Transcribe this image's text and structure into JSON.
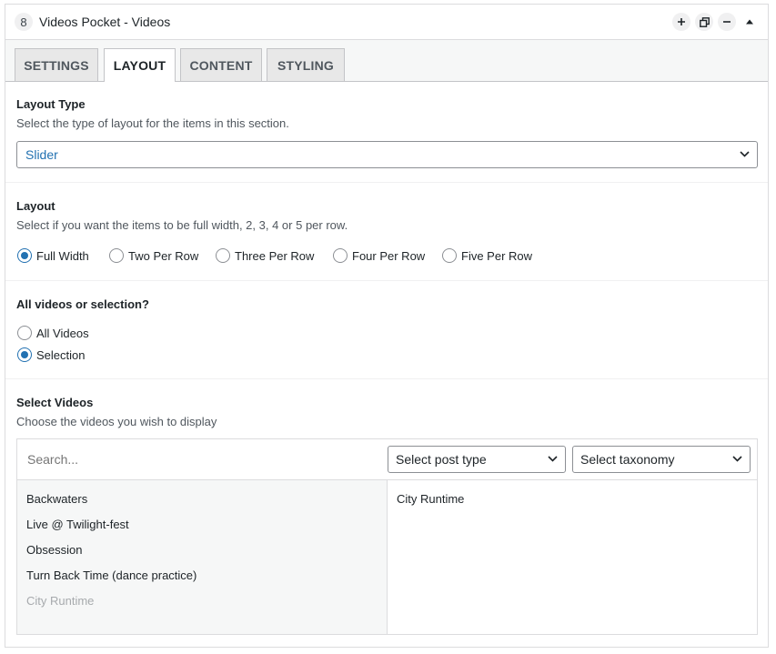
{
  "header": {
    "badge": "8",
    "title": "Videos Pocket - Videos"
  },
  "tabs": [
    {
      "label": "SETTINGS"
    },
    {
      "label": "LAYOUT"
    },
    {
      "label": "CONTENT"
    },
    {
      "label": "STYLING"
    }
  ],
  "active_tab": "LAYOUT",
  "layout_type": {
    "title": "Layout Type",
    "description": "Select the type of layout for the items in this section.",
    "value": "Slider"
  },
  "layout": {
    "title": "Layout",
    "description": "Select if you want the items to be full width, 2, 3, 4 or 5 per row.",
    "options": [
      "Full Width",
      "Two Per Row",
      "Three Per Row",
      "Four Per Row",
      "Five Per Row"
    ],
    "selected": "Full Width"
  },
  "videos_mode": {
    "title": "All videos or selection?",
    "options": [
      "All Videos",
      "Selection"
    ],
    "selected": "Selection"
  },
  "select_videos": {
    "title": "Select Videos",
    "description": "Choose the videos you wish to display",
    "search_placeholder": "Search...",
    "post_type_label": "Select post type",
    "taxonomy_label": "Select taxonomy",
    "available": [
      "Backwaters",
      "Live @ Twilight-fest",
      "Obsession",
      "Turn Back Time (dance practice)",
      "City Runtime"
    ],
    "selected": [
      "City Runtime"
    ]
  },
  "colors": {
    "accent": "#2271b1",
    "muted_text": "#a7aaad",
    "border": "#dcdcde"
  }
}
